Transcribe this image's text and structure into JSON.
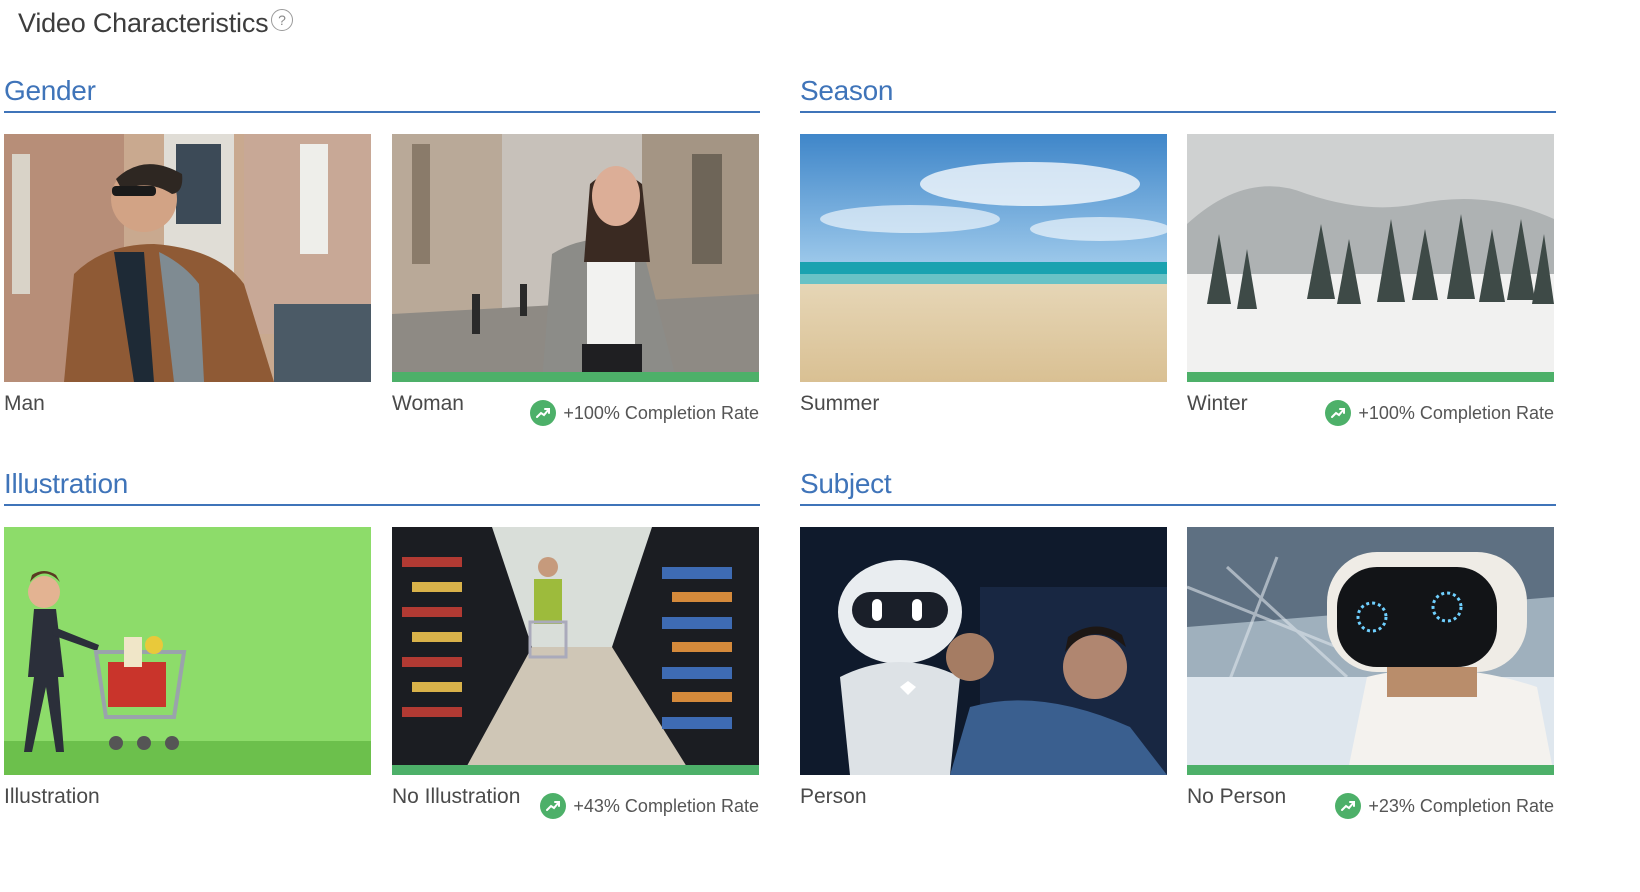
{
  "page": {
    "title": "Video Characteristics",
    "help_icon": "question-circle-icon",
    "help_glyph": "?"
  },
  "colors": {
    "accent": "#3f74b9",
    "winner": "#4db069"
  },
  "sections": [
    {
      "title": "Gender",
      "cards": [
        {
          "label": "Man",
          "image": "man-in-brown-jacket-street",
          "winner": false
        },
        {
          "label": "Woman",
          "image": "woman-walking-street",
          "winner": true,
          "rate": "+100% Completion Rate",
          "icon": "trending-up-icon"
        }
      ]
    },
    {
      "title": "Season",
      "cards": [
        {
          "label": "Summer",
          "image": "sunny-beach",
          "winner": false
        },
        {
          "label": "Winter",
          "image": "snowy-pine-forest",
          "winner": true,
          "rate": "+100% Completion Rate",
          "icon": "trending-up-icon"
        }
      ]
    },
    {
      "title": "Illustration",
      "cards": [
        {
          "label": "Illustration",
          "image": "cartoon-woman-shopping-cart",
          "winner": false
        },
        {
          "label": "No Illustration",
          "image": "woman-in-supermarket-aisle",
          "winner": true,
          "rate": "+43% Completion Rate",
          "icon": "trending-up-icon"
        }
      ]
    },
    {
      "title": "Subject",
      "cards": [
        {
          "label": "Person",
          "image": "man-with-white-robot",
          "winner": false
        },
        {
          "label": "No Person",
          "image": "robot-close-up",
          "winner": true,
          "rate": "+23% Completion Rate",
          "icon": "trending-up-icon"
        }
      ]
    }
  ]
}
